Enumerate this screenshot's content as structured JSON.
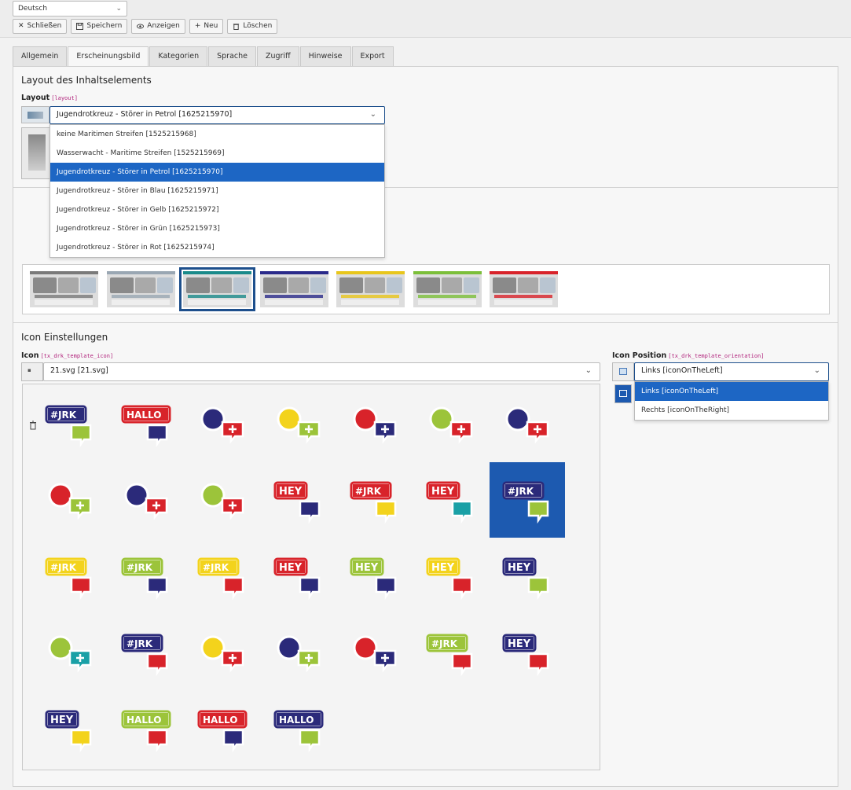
{
  "language": {
    "value": "Deutsch"
  },
  "toolbar": {
    "close_label": "Schließen",
    "save_label": "Speichern",
    "view_label": "Anzeigen",
    "new_label": "Neu",
    "delete_label": "Löschen"
  },
  "tabs": [
    "Allgemein",
    "Erscheinungsbild",
    "Kategorien",
    "Sprache",
    "Zugriff",
    "Hinweise",
    "Export"
  ],
  "layout_section": {
    "title": "Layout des Inhaltselements",
    "field_label": "Layout",
    "field_key": "[layout]",
    "selected": "Jugendrotkreuz - Störer in Petrol [1625215970]",
    "options": [
      "keine Maritimen Streifen [1525215968]",
      "Wasserwacht - Maritime Streifen [1525215969]",
      "Jugendrotkreuz - Störer in Petrol [1625215970]",
      "Jugendrotkreuz - Störer in Blau [1625215971]",
      "Jugendrotkreuz - Störer in Gelb [1625215972]",
      "Jugendrotkreuz - Störer in Grün [1625215973]",
      "Jugendrotkreuz - Störer in Rot [1625215974]"
    ],
    "selected_index": 2,
    "gallery_colors": [
      "#7a7a7a",
      "#9aa7b3",
      "#1a8a8a",
      "#2a2a8a",
      "#e8c61c",
      "#7cbf3a",
      "#d8232a"
    ],
    "gallery_active_index": 2
  },
  "icon_section": {
    "title": "Icon Einstellungen",
    "icon_label": "Icon",
    "icon_key": "[tx_drk_template_icon]",
    "icon_value": "21.svg [21.svg]",
    "position_label": "Icon Position",
    "position_key": "[tx_drk_template_orientation]",
    "position_value": "Links [iconOnTheLeft]",
    "position_options": [
      "Links [iconOnTheLeft]",
      "Rechts [iconOnTheRight]"
    ],
    "position_selected_index": 0,
    "active_icon_index": 13,
    "icons": [
      {
        "name": "jrk-speech-bubble",
        "text": "#JRK",
        "main": "#2b2a7a",
        "accent": "#9cc43a"
      },
      {
        "name": "hallo-paper-plane",
        "text": "HALLO",
        "main": "#d8232a",
        "accent": "#2b2a7a"
      },
      {
        "name": "group-paper-plane",
        "text": "",
        "main": "#2b2a7a",
        "accent": "#d8232a"
      },
      {
        "name": "group-paper-plane-yellow",
        "text": "",
        "main": "#f3d31c",
        "accent": "#9cc43a"
      },
      {
        "name": "bandage-chat-cross",
        "text": "",
        "main": "#d8232a",
        "accent": "#2b2a7a"
      },
      {
        "name": "bandage-chat-cross-green",
        "text": "",
        "main": "#9cc43a",
        "accent": "#d8232a"
      },
      {
        "name": "bandage-ambulance",
        "text": "",
        "main": "#2b2a7a",
        "accent": "#d8232a"
      },
      {
        "name": "bandage-ambulance-green",
        "text": "",
        "main": "#d8232a",
        "accent": "#9cc43a"
      },
      {
        "name": "face-chat-cross",
        "text": "",
        "main": "#2b2a7a",
        "accent": "#d8232a"
      },
      {
        "name": "face-chat-cross-green",
        "text": "",
        "main": "#9cc43a",
        "accent": "#d8232a"
      },
      {
        "name": "heart-hey",
        "text": "HEY",
        "main": "#d8232a",
        "accent": "#2b2a7a"
      },
      {
        "name": "jrk-speech-yellow",
        "text": "#JRK",
        "main": "#d8232a",
        "accent": "#f3d31c"
      },
      {
        "name": "heart-hey-teal",
        "text": "HEY",
        "main": "#d8232a",
        "accent": "#1aa0a6"
      },
      {
        "name": "jrk-heart-blue",
        "text": "#JRK",
        "main": "#2b2a7a",
        "accent": "#9cc43a"
      },
      {
        "name": "jrk-heart-red",
        "text": "#JRK",
        "main": "#f3d31c",
        "accent": "#d8232a"
      },
      {
        "name": "thumb-jrk",
        "text": "#JRK",
        "main": "#9cc43a",
        "accent": "#2b2a7a"
      },
      {
        "name": "thumb-jrk-yellow",
        "text": "#JRK",
        "main": "#f3d31c",
        "accent": "#d8232a"
      },
      {
        "name": "hey-boat",
        "text": "HEY",
        "main": "#d8232a",
        "accent": "#2b2a7a"
      },
      {
        "name": "hey-boat-green",
        "text": "HEY",
        "main": "#9cc43a",
        "accent": "#2b2a7a"
      },
      {
        "name": "clap-hey",
        "text": "HEY",
        "main": "#f3d31c",
        "accent": "#d8232a"
      },
      {
        "name": "clap-hey-green",
        "text": "HEY",
        "main": "#2b2a7a",
        "accent": "#9cc43a"
      },
      {
        "name": "group-heart-chat",
        "text": "",
        "main": "#9cc43a",
        "accent": "#1aa0a6"
      },
      {
        "name": "jrk-big-heart",
        "text": "#JRK",
        "main": "#2b2a7a",
        "accent": "#d8232a"
      },
      {
        "name": "group-heart-chat-yellow",
        "text": "",
        "main": "#f3d31c",
        "accent": "#d8232a"
      },
      {
        "name": "rocket-hand",
        "text": "",
        "main": "#2b2a7a",
        "accent": "#9cc43a"
      },
      {
        "name": "rocket-hand-red",
        "text": "",
        "main": "#d8232a",
        "accent": "#2b2a7a"
      },
      {
        "name": "jrk-big-heart-green",
        "text": "#JRK",
        "main": "#9cc43a",
        "accent": "#d8232a"
      },
      {
        "name": "boat-hey",
        "text": "HEY",
        "main": "#2b2a7a",
        "accent": "#d8232a"
      },
      {
        "name": "boat-hey-yellow",
        "text": "HEY",
        "main": "#2b2a7a",
        "accent": "#f3d31c"
      },
      {
        "name": "hallo-megaphone",
        "text": "HALLO",
        "main": "#9cc43a",
        "accent": "#d8232a"
      },
      {
        "name": "hallo-megaphone-red",
        "text": "HALLO",
        "main": "#d8232a",
        "accent": "#2b2a7a"
      },
      {
        "name": "hallo-paper-plane-blue",
        "text": "HALLO",
        "main": "#2b2a7a",
        "accent": "#9cc43a"
      }
    ]
  }
}
